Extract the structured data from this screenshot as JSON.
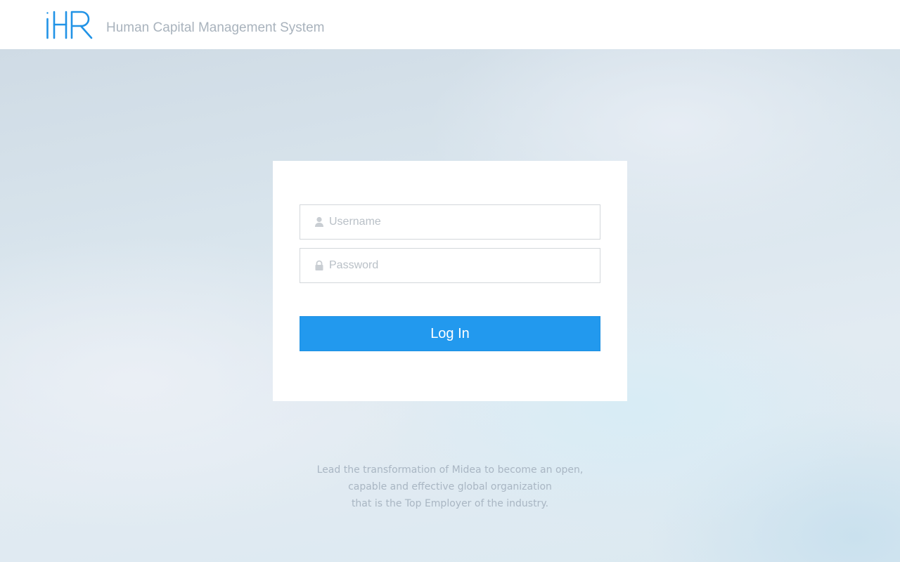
{
  "header": {
    "logo_text": "iHR",
    "title": "Human Capital Management System"
  },
  "login": {
    "username_placeholder": "Username",
    "password_placeholder": "Password",
    "login_label": "Log In"
  },
  "tagline": {
    "lines": [
      "Lead the transformation of Midea to become an open,",
      "capable and effective global organization",
      "that is the Top Employer of the industry."
    ]
  },
  "icons": {
    "username": "user-icon",
    "password": "lock-icon"
  },
  "colors": {
    "brand": "#2299ee",
    "header_text": "#a9b3bd",
    "placeholder": "#b9c0c7",
    "tagline": "#a9b6c3"
  }
}
